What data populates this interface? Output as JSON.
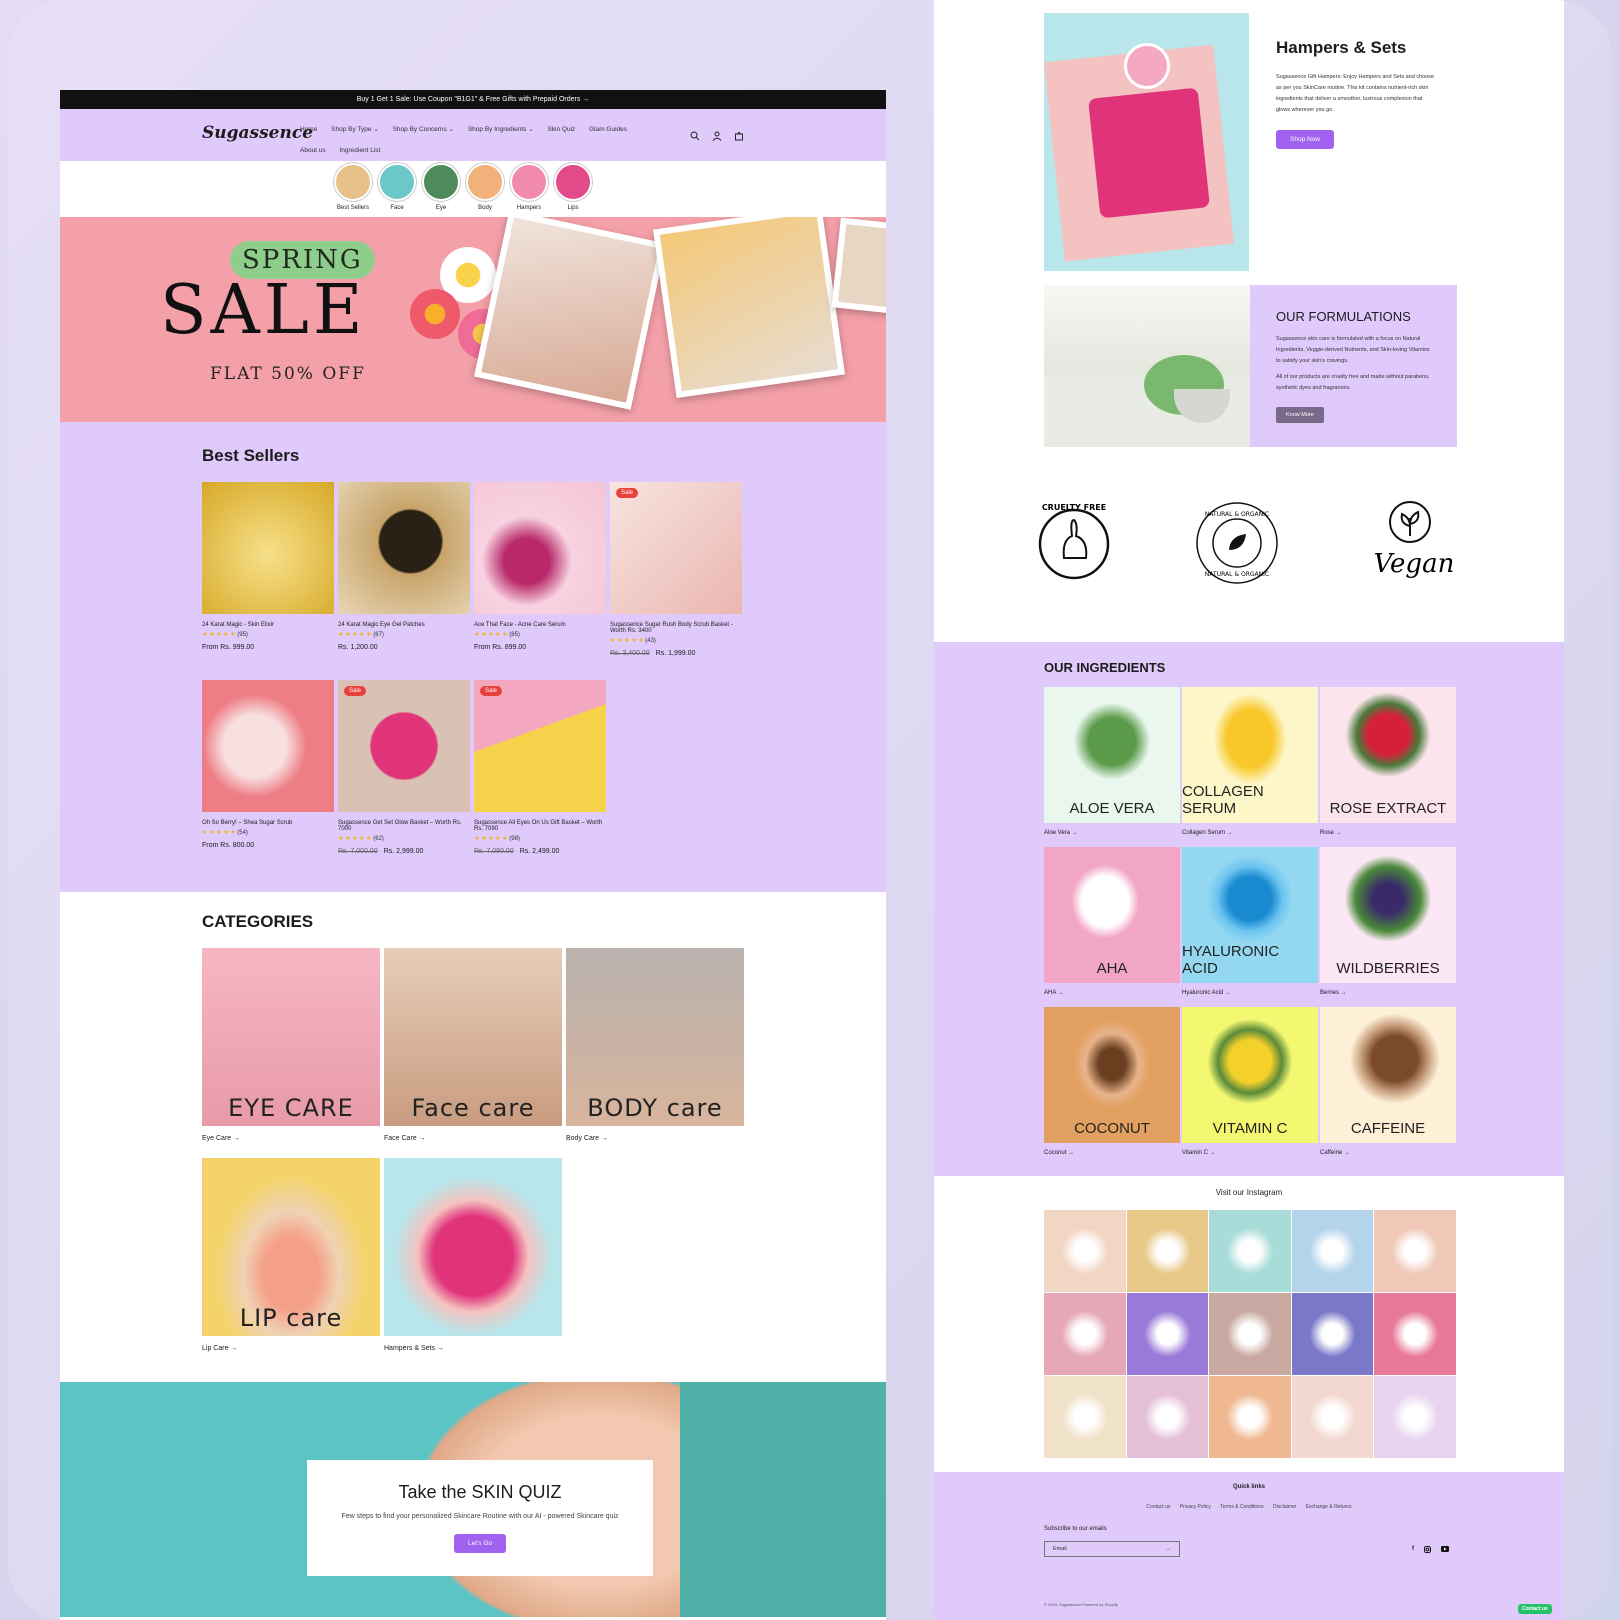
{
  "announcement": "Buy 1 Get 1 Sale: Use Coupon \"B1G1\" & Free Gifts with Prepaid Orders →",
  "brand": "Sugassence",
  "nav": {
    "items": [
      "Home",
      "Shop By Type ⌄",
      "Shop By Concerns ⌄",
      "Shop By Ingredients ⌄",
      "Skin Quiz",
      "Glam Guides",
      "About us",
      "Ingredient List"
    ],
    "icons": [
      "search-icon",
      "account-icon",
      "cart-icon"
    ]
  },
  "circles": [
    "Best Sellers",
    "Face",
    "Eye",
    "Body",
    "Hampers",
    "Lips"
  ],
  "hero": {
    "line1": "SPRING",
    "line2": "SALE",
    "line3": "FLAT 50% OFF"
  },
  "best_sellers": {
    "title": "Best Sellers",
    "products": [
      {
        "name": "24 Karat Magic - Skin Elixir",
        "stars": "★ ★ ★ ★ ★",
        "reviews": "(95)",
        "price": "From Rs. 999.00",
        "old": "",
        "badge": "",
        "color": "#e8c742"
      },
      {
        "name": "24 Karat Magic Eye Gel Patches",
        "stars": "★ ★ ★ ★ ★",
        "reviews": "(67)",
        "price": "Rs. 1,200.00",
        "old": "",
        "badge": "",
        "color": "#c8a46a"
      },
      {
        "name": "Ace That Face - Acne Care Serum",
        "stars": "★ ★ ★ ★ ★",
        "reviews": "(85)",
        "price": "From Rs. 899.00",
        "old": "",
        "badge": "",
        "color": "#f4c4d4"
      },
      {
        "name": "Sugassence Sugar Rush Body Scrub Basket - Worth Rs. 3400",
        "stars": "★ ★ ★ ★ ★",
        "reviews": "(43)",
        "price": "Rs. 1,999.00",
        "old": "Rs. 3,400.00",
        "badge": "Sale",
        "color": "#f1d6d2"
      },
      {
        "name": "Oh So Berry! – Shea Sugar Scrub",
        "stars": "★ ★ ★ ★ ★",
        "reviews": "(54)",
        "price": "From Rs. 800.00",
        "old": "",
        "badge": "",
        "color": "#ee7e86"
      },
      {
        "name": "Sugassence Get Set Glow Basket – Worth Rs. 7000",
        "stars": "★ ★ ★ ★ ★",
        "reviews": "(62)",
        "price": "Rs. 2,999.00",
        "old": "Rs. 7,000.00",
        "badge": "Sale",
        "color": "#d9c2b4"
      },
      {
        "name": "Sugassence All Eyes On Us Gift Basket – Worth Rs. 7090",
        "stars": "★ ★ ★ ★ ★",
        "reviews": "(98)",
        "price": "Rs. 2,499.00",
        "old": "Rs. 7,090.00",
        "badge": "Sale",
        "color": "#f6d24a"
      }
    ]
  },
  "categories": {
    "title": "CATEGORIES",
    "items": [
      {
        "overlay": "EYE CARE",
        "label": "Eye Care →",
        "color": "#f4a7b9"
      },
      {
        "overlay": "Face care",
        "label": "Face Care →",
        "color": "#d8b8a0"
      },
      {
        "overlay": "BODY care",
        "label": "Body Care →",
        "color": "#b2aca8"
      },
      {
        "overlay": "LIP care",
        "label": "Lip Care →",
        "color": "#f3d36a"
      },
      {
        "overlay": "",
        "label": "Hampers & Sets →",
        "color": "#b8e6ea"
      }
    ]
  },
  "quiz": {
    "title": "Take the SKIN QUIZ",
    "text": "Few steps to find your personalized Skincare Routine with our AI - powered Skincare quiz",
    "button": "Let's Go"
  },
  "hampers": {
    "title": "Hampers & Sets",
    "text": "Sugassence Gift Hampers: Enjoy Hampers and Sets and choose as per you SkinCare routine. This kit contains nutrient-rich skin ingredients that deliver a smoother, lustrous complexion that glows wherever you go.",
    "button": "Shop Now"
  },
  "formulations": {
    "title": "OUR FORMULATIONS",
    "p1": "Sugassence skin care is formulated with a focus on Natural Ingredients, Veggie-derived Nutrients, and Skin-loving Vitamins to satisfy your skin's cravings.",
    "p2": "All of our products are cruelty free and made without parabens, synthetic dyes and fragrances.",
    "button": "Know More"
  },
  "badges": {
    "cruelty": "CRUELTY FREE",
    "natural": "NATURAL & ORGANIC",
    "vegan": "Vegan"
  },
  "ingredients": {
    "title": "OUR INGREDIENTS",
    "items": [
      {
        "overlay": "ALOE VERA",
        "label": "Aloe Vera →",
        "color": "#e9f7ee"
      },
      {
        "overlay": "COLLAGEN SERUM",
        "label": "Collagen Serum →",
        "color": "#fdf6c8"
      },
      {
        "overlay": "ROSE EXTRACT",
        "label": "Rose →",
        "color": "#fbe4ec"
      },
      {
        "overlay": "AHA",
        "label": "AHA →",
        "color": "#f2a6c6"
      },
      {
        "overlay": "HYALURONIC ACID",
        "label": "Hyaluronic Acid →",
        "color": "#93d8f0"
      },
      {
        "overlay": "WILDBERRIES",
        "label": "Berries →",
        "color": "#fce8f4"
      },
      {
        "overlay": "COCONUT",
        "label": "Coconut →",
        "color": "#e2a060"
      },
      {
        "overlay": "VITAMIN C",
        "label": "Vitamin C →",
        "color": "#f4f870"
      },
      {
        "overlay": "CAFFEINE",
        "label": "Caffeine →",
        "color": "#fdf0d6"
      }
    ]
  },
  "instagram": {
    "title": "Visit our Instagram",
    "tiles": [
      "#f2d6c4",
      "#e8c98a",
      "#a8dcd8",
      "#b4d4ec",
      "#f0c8b8",
      "#e6a8b8",
      "#9a7ad8",
      "#c8a8a0",
      "#7a78c8",
      "#e87898",
      "#f0e2c8",
      "#e4c0d8",
      "#f0b890",
      "#f2d8d0",
      "#e8d4ee"
    ]
  },
  "footer": {
    "quick_links": "Quick links",
    "links": [
      "Contact us",
      "Privacy Policy",
      "Terms & Conditions",
      "Disclaimer",
      "Exchange & Returns"
    ],
    "subscribe": "Subscribe to our emails",
    "email_placeholder": "Email",
    "social": [
      "facebook-icon",
      "instagram-icon",
      "youtube-icon"
    ],
    "copyright": "© 2024, Sugassence Powered by Shopify"
  },
  "chat": "Contact us"
}
